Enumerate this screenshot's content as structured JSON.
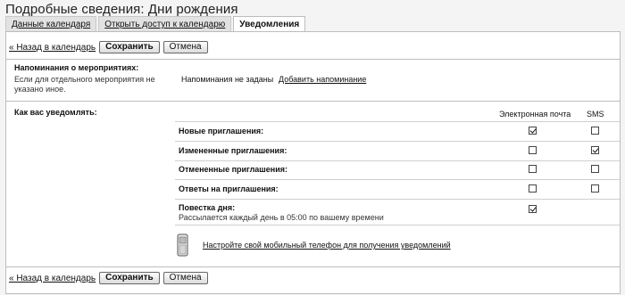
{
  "window": {
    "title": "Подробные сведения: Дни рождения"
  },
  "tabs": [
    {
      "label": "Данные календаря",
      "active": false
    },
    {
      "label": "Открыть доступ к календарю",
      "active": false
    },
    {
      "label": "Уведомления",
      "active": true
    }
  ],
  "toolbar": {
    "back_link": "« Назад в календарь",
    "save_label": "Сохранить",
    "cancel_label": "Отмена"
  },
  "event_reminders": {
    "heading": "Напоминания о мероприятиях:",
    "description_line1": "Если для отдельного мероприятия не",
    "description_line2": "указано иное.",
    "status": "Напоминания не заданы",
    "add_link": "Добавить напоминание"
  },
  "notify": {
    "heading": "Как вас уведомлять:",
    "columns": {
      "email": "Электронная почта",
      "sms": "SMS"
    },
    "rows": [
      {
        "label": "Новые приглашения:",
        "email": true,
        "sms": false
      },
      {
        "label": "Измененные приглашения:",
        "email": false,
        "sms": true
      },
      {
        "label": "Отмененные приглашения:",
        "email": false,
        "sms": false
      },
      {
        "label": "Ответы на приглашения:",
        "email": false,
        "sms": false
      },
      {
        "label": "Повестка дня:",
        "sublabel": "Рассылается каждый день в 05:00 по вашему времени",
        "email": true,
        "sms": null
      }
    ],
    "mobile_link": "Настройте свой мобильный телефон для получения уведомлений",
    "mobile_icon": "mobile-phone-icon"
  }
}
